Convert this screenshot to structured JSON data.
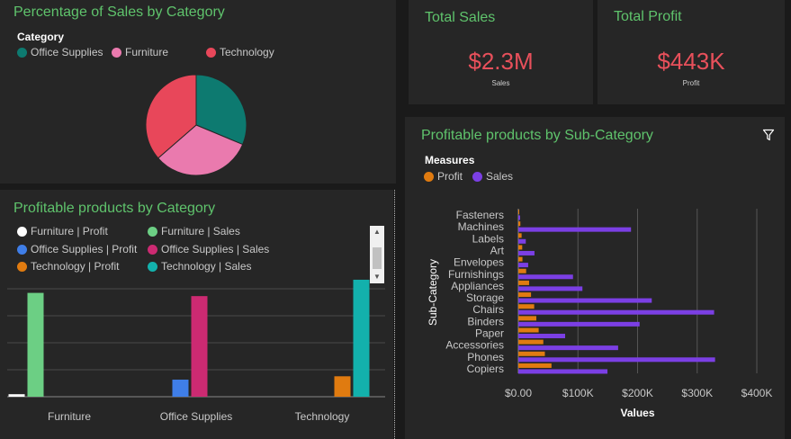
{
  "pie_panel": {
    "title": "Percentage of Sales by Category",
    "legend_title": "Category",
    "legend": [
      {
        "label": "Office Supplies",
        "color": "#0d7a70"
      },
      {
        "label": "Furniture",
        "color": "#ea7aae"
      },
      {
        "label": "Technology",
        "color": "#e8475a"
      }
    ]
  },
  "kpi_sales": {
    "title": "Total Sales",
    "value": "$2.3M",
    "caption": "Sales"
  },
  "kpi_profit": {
    "title": "Total Profit",
    "value": "$443K",
    "caption": "Profit"
  },
  "cat_panel": {
    "title": "Profitable products by Category",
    "legend": [
      {
        "label": "Furniture | Profit",
        "color": "#ffffff"
      },
      {
        "label": "Furniture | Sales",
        "color": "#6ccf84"
      },
      {
        "label": "Office Supplies | Profit",
        "color": "#3f7ee8"
      },
      {
        "label": "Office Supplies | Sales",
        "color": "#cc2a72"
      },
      {
        "label": "Technology | Profit",
        "color": "#e07b10"
      },
      {
        "label": "Technology | Sales",
        "color": "#13b1ac"
      }
    ],
    "categories": [
      "Furniture",
      "Office Supplies",
      "Technology"
    ]
  },
  "sub_panel": {
    "title": "Profitable products by Sub-Category",
    "legend_title": "Measures",
    "legend": [
      {
        "label": "Profit",
        "color": "#e07b10"
      },
      {
        "label": "Sales",
        "color": "#7b3fe4"
      }
    ],
    "filter_icon": "filter-icon"
  },
  "chart_data": [
    {
      "type": "pie",
      "title": "Percentage of Sales by Category",
      "categories": [
        "Office Supplies",
        "Furniture",
        "Technology"
      ],
      "values": [
        31.3,
        32.3,
        36.4
      ],
      "colors": [
        "#0d7a70",
        "#ea7aae",
        "#e8475a"
      ]
    },
    {
      "type": "bar",
      "title": "Profitable products by Category",
      "categories": [
        "Furniture",
        "Office Supplies",
        "Technology"
      ],
      "ylim": [
        0,
        900000
      ],
      "series": [
        {
          "name": "Furniture | Profit",
          "values": [
            18000,
            null,
            null
          ],
          "color": "#ffffff"
        },
        {
          "name": "Furniture | Sales",
          "values": [
            742000,
            null,
            null
          ],
          "color": "#6ccf84"
        },
        {
          "name": "Office Supplies | Profit",
          "values": [
            null,
            122000,
            null
          ],
          "color": "#3f7ee8"
        },
        {
          "name": "Office Supplies | Sales",
          "values": [
            null,
            719000,
            null
          ],
          "color": "#cc2a72"
        },
        {
          "name": "Technology | Profit",
          "values": [
            null,
            null,
            146000
          ],
          "color": "#e07b10"
        },
        {
          "name": "Technology | Sales",
          "values": [
            null,
            null,
            836000
          ],
          "color": "#13b1ac"
        }
      ]
    },
    {
      "type": "bar",
      "orientation": "horizontal",
      "title": "Profitable products by Sub-Category",
      "xlabel": "Values",
      "ylabel": "Sub-Category",
      "xlim": [
        0,
        400000
      ],
      "xticks": [
        "$0.00",
        "$100K",
        "$200K",
        "$300K",
        "$400K"
      ],
      "categories": [
        "Fasteners",
        "Machines",
        "Labels",
        "Art",
        "Envelopes",
        "Furnishings",
        "Appliances",
        "Storage",
        "Chairs",
        "Binders",
        "Paper",
        "Accessories",
        "Phones",
        "Copiers"
      ],
      "series": [
        {
          "name": "Profit",
          "color": "#e07b10",
          "values": [
            950,
            3400,
            5500,
            6500,
            6900,
            13100,
            18100,
            21300,
            26600,
            30200,
            34100,
            41900,
            44500,
            55600
          ]
        },
        {
          "name": "Sales",
          "color": "#7b3fe4",
          "values": [
            3000,
            189000,
            12500,
            27100,
            16500,
            91700,
            107500,
            223800,
            328400,
            203400,
            78500,
            167400,
            330000,
            149500
          ]
        }
      ]
    }
  ]
}
